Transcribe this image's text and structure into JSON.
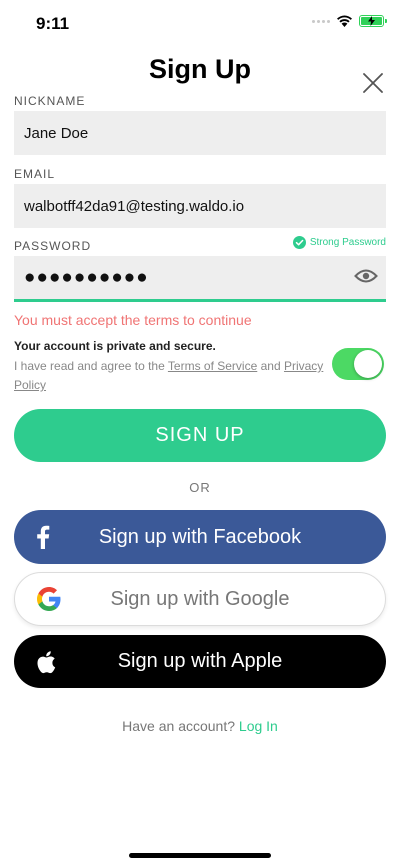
{
  "status_bar": {
    "time": "9:11",
    "icons": [
      "cellular-signal-icon",
      "wifi-icon",
      "battery-charging-icon"
    ]
  },
  "header": {
    "title": "Sign Up",
    "close_icon": "close-icon"
  },
  "form": {
    "nickname": {
      "label": "NICKNAME",
      "value": "Jane Doe"
    },
    "email": {
      "label": "EMAIL",
      "value": "walbotff42da91@testing.waldo.io"
    },
    "password": {
      "label": "PASSWORD",
      "masked_value": "●●●●●●●●●●",
      "strength_text": "Strong Password",
      "visibility_icon": "eye-icon"
    }
  },
  "terms": {
    "error": "You must accept the terms to continue",
    "private_note": "Your account is private and secure.",
    "agree_prefix": "I have read and agree to the ",
    "tos_link": "Terms of Service",
    "and_text": " and ",
    "privacy_link": "Privacy Policy",
    "toggle_on": true
  },
  "buttons": {
    "signup": "SIGN UP",
    "or": "OR",
    "facebook": "Sign up with Facebook",
    "google": "Sign up with Google",
    "apple": "Sign up with Apple"
  },
  "footer": {
    "have_account": "Have an account?",
    "login": "Log In"
  },
  "colors": {
    "accent": "#2ecc8e",
    "error": "#f07474",
    "facebook": "#3b5998",
    "apple": "#000000",
    "toggle": "#4cd964"
  }
}
